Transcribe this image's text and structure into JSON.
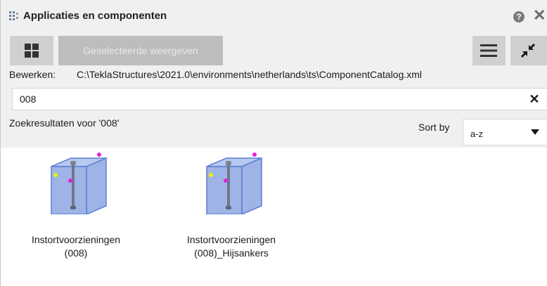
{
  "window": {
    "title": "Applicaties en componenten"
  },
  "toolbar": {
    "show_selected_label": "Geselecteerde weergeven"
  },
  "path": {
    "label": "Bewerken:",
    "value": "C:\\TeklaStructures\\2021.0\\environments\\netherlands\\ts\\ComponentCatalog.xml"
  },
  "search": {
    "value": "008"
  },
  "results": {
    "header": "Zoekresultaten voor '008'",
    "sort_label": "Sort by",
    "sort_value": "a-z",
    "items": [
      {
        "line1": "Instortvoorzieningen",
        "line2": "(008)",
        "icon": "embed-component-icon"
      },
      {
        "line1": "Instortvoorzieningen",
        "line2": "(008)_Hijsankers",
        "icon": "embed-component-icon"
      }
    ]
  },
  "colors": {
    "panel_bg": "#f0f0f0",
    "button_bg": "#d0d0d0",
    "disabled_button_bg": "#bdbdbd",
    "icon_box": "#5b7fd4",
    "icon_handle_magenta": "#e020e0",
    "icon_handle_yellow": "#f0f000"
  }
}
